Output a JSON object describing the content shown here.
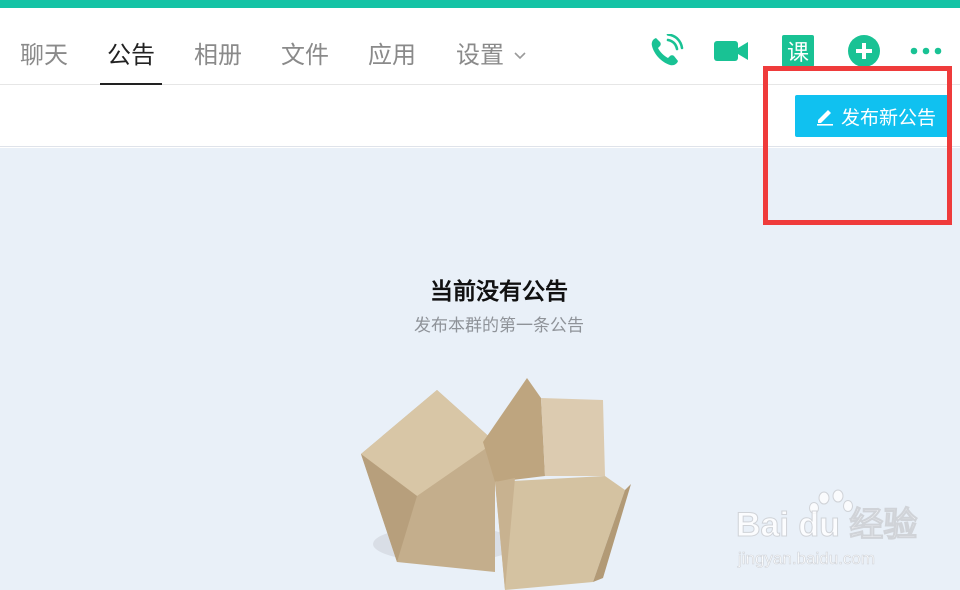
{
  "colors": {
    "accent_top": "#14c3a5",
    "icon_green": "#19c294",
    "button_blue": "#10c1f0",
    "content_bg": "#e9f0f8",
    "highlight_red": "#ef3b3b"
  },
  "tabs": [
    {
      "label": "聊天"
    },
    {
      "label": "公告",
      "active": true
    },
    {
      "label": "相册"
    },
    {
      "label": "文件"
    },
    {
      "label": "应用"
    },
    {
      "label": "设置"
    }
  ],
  "toolbar_icons": [
    "phone-icon",
    "video-call-icon",
    "course-icon",
    "add-icon",
    "more-icon"
  ],
  "course_icon_text": "课",
  "publish_button": {
    "label": "发布新公告"
  },
  "empty_state": {
    "title": "当前没有公告",
    "subtitle": "发布本群的第一条公告"
  },
  "watermark": {
    "brand": "Bai du 经验",
    "url": "jingyan.baidu.com"
  }
}
